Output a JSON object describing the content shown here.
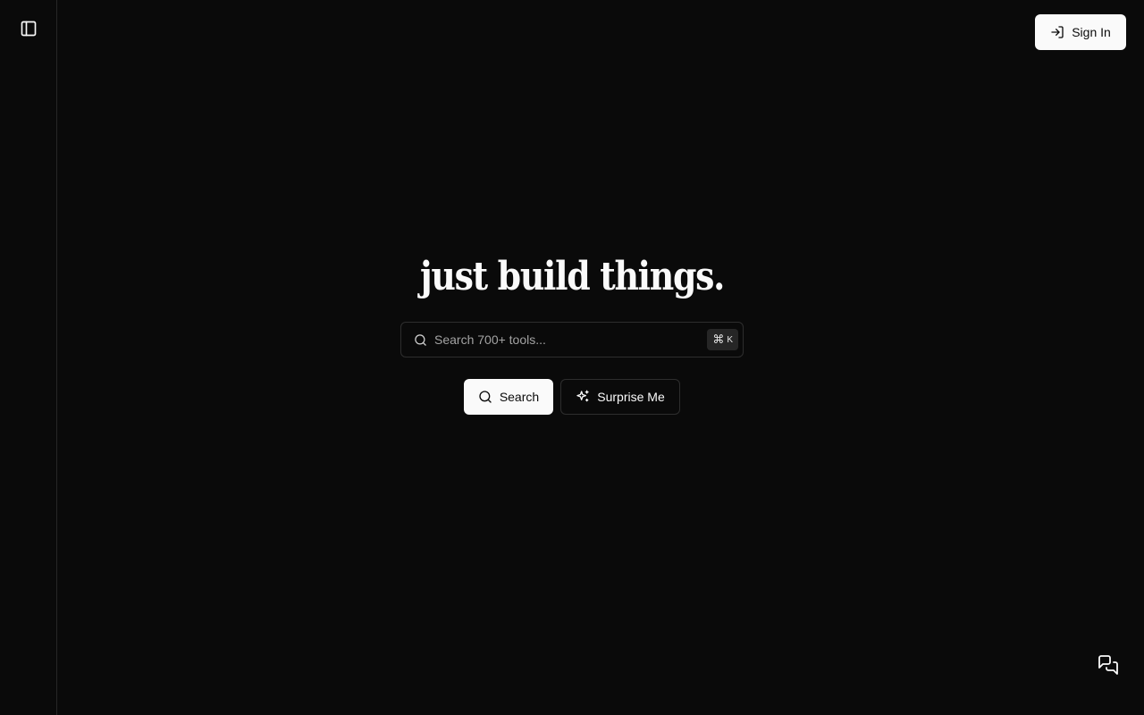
{
  "header": {
    "signin_label": "Sign In"
  },
  "hero": {
    "title": "just build things."
  },
  "search": {
    "placeholder": "Search 700+ tools...",
    "shortcut_symbol": "⌘",
    "shortcut_key": "K"
  },
  "actions": {
    "search_label": "Search",
    "surprise_label": "Surprise Me"
  },
  "icons": {
    "sidebar_toggle": "panel-left-icon",
    "signin": "log-in-icon",
    "search": "search-icon",
    "sparkles": "sparkles-icon",
    "feedback": "messages-icon"
  },
  "colors": {
    "background": "#0a0a0a",
    "foreground": "#fafafa",
    "border": "#262626",
    "muted": "#a3a3a3"
  }
}
